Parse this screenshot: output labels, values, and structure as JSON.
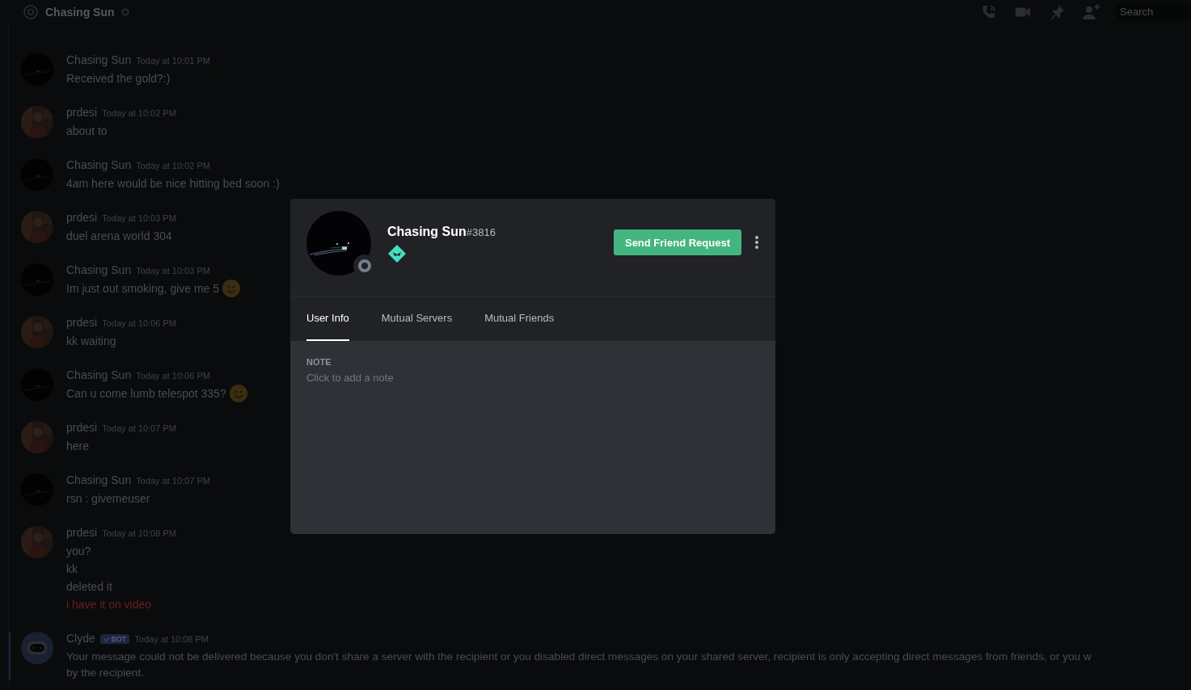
{
  "header": {
    "title": "Chasing Sun",
    "online": false,
    "search": {
      "placeholder": "Search"
    }
  },
  "messages": [
    {
      "author": "Chasing Sun",
      "kind": "night",
      "time": "Today at 10:01 PM",
      "lines": [
        {
          "text": "Received the gold?:)",
          "kind": "plain"
        }
      ]
    },
    {
      "author": "prdesi",
      "kind": "person",
      "time": "Today at 10:02 PM",
      "lines": [
        {
          "text": "about to",
          "kind": "plain"
        }
      ]
    },
    {
      "author": "Chasing Sun",
      "kind": "night",
      "time": "Today at 10:02 PM",
      "lines": [
        {
          "text": "4am here would be nice hitting bed soon :)",
          "kind": "plain"
        }
      ]
    },
    {
      "author": "prdesi",
      "kind": "person",
      "time": "Today at 10:03 PM",
      "lines": [
        {
          "text": "duel arena world 304",
          "kind": "plain"
        }
      ]
    },
    {
      "author": "Chasing Sun",
      "kind": "night",
      "time": "Today at 10:03 PM",
      "lines": [
        {
          "text": "Im just out smoking, give me 5",
          "kind": "emoji"
        }
      ]
    },
    {
      "author": "prdesi",
      "kind": "person",
      "time": "Today at 10:06 PM",
      "lines": [
        {
          "text": "kk waiting",
          "kind": "plain"
        }
      ]
    },
    {
      "author": "Chasing Sun",
      "kind": "night",
      "time": "Today at 10:06 PM",
      "lines": [
        {
          "text": "Can u come lumb telespot 335?",
          "kind": "emoji"
        }
      ]
    },
    {
      "author": "prdesi",
      "kind": "person",
      "time": "Today at 10:07 PM",
      "lines": [
        {
          "text": "here",
          "kind": "plain"
        }
      ]
    },
    {
      "author": "Chasing Sun",
      "kind": "night",
      "time": "Today at 10:07 PM",
      "lines": [
        {
          "text": "rsn : givemeuser",
          "kind": "plain"
        }
      ]
    },
    {
      "author": "prdesi",
      "kind": "person",
      "time": "Today at 10:08 PM",
      "lines": [
        {
          "text": "you?",
          "kind": "plain"
        },
        {
          "text": "kk",
          "kind": "plain"
        },
        {
          "text": "deleted it",
          "kind": "plain"
        },
        {
          "text": "i have it on video",
          "kind": "failed"
        }
      ]
    },
    {
      "author": "Clyde",
      "kind": "bot",
      "badge": "BOT",
      "time": "Today at 10:08 PM",
      "lines": [
        {
          "text": "Your message could not be delivered because you don't share a server with the recipient or you disabled direct messages on your shared server, recipient is only accepting direct messages from friends, or you w",
          "kind": "plain"
        },
        {
          "text": "by the recipient.",
          "kind": "plain"
        }
      ]
    }
  ],
  "profile": {
    "name": "Chasing Sun",
    "tag": "#3816",
    "online": false,
    "button": "Send Friend Request",
    "tabs": [
      {
        "label": "User Info",
        "selected": true
      },
      {
        "label": "Mutual Servers",
        "selected": false
      },
      {
        "label": "Mutual Friends",
        "selected": false
      }
    ],
    "note": {
      "label": "NOTE",
      "placeholder": "Click to add a note"
    }
  }
}
